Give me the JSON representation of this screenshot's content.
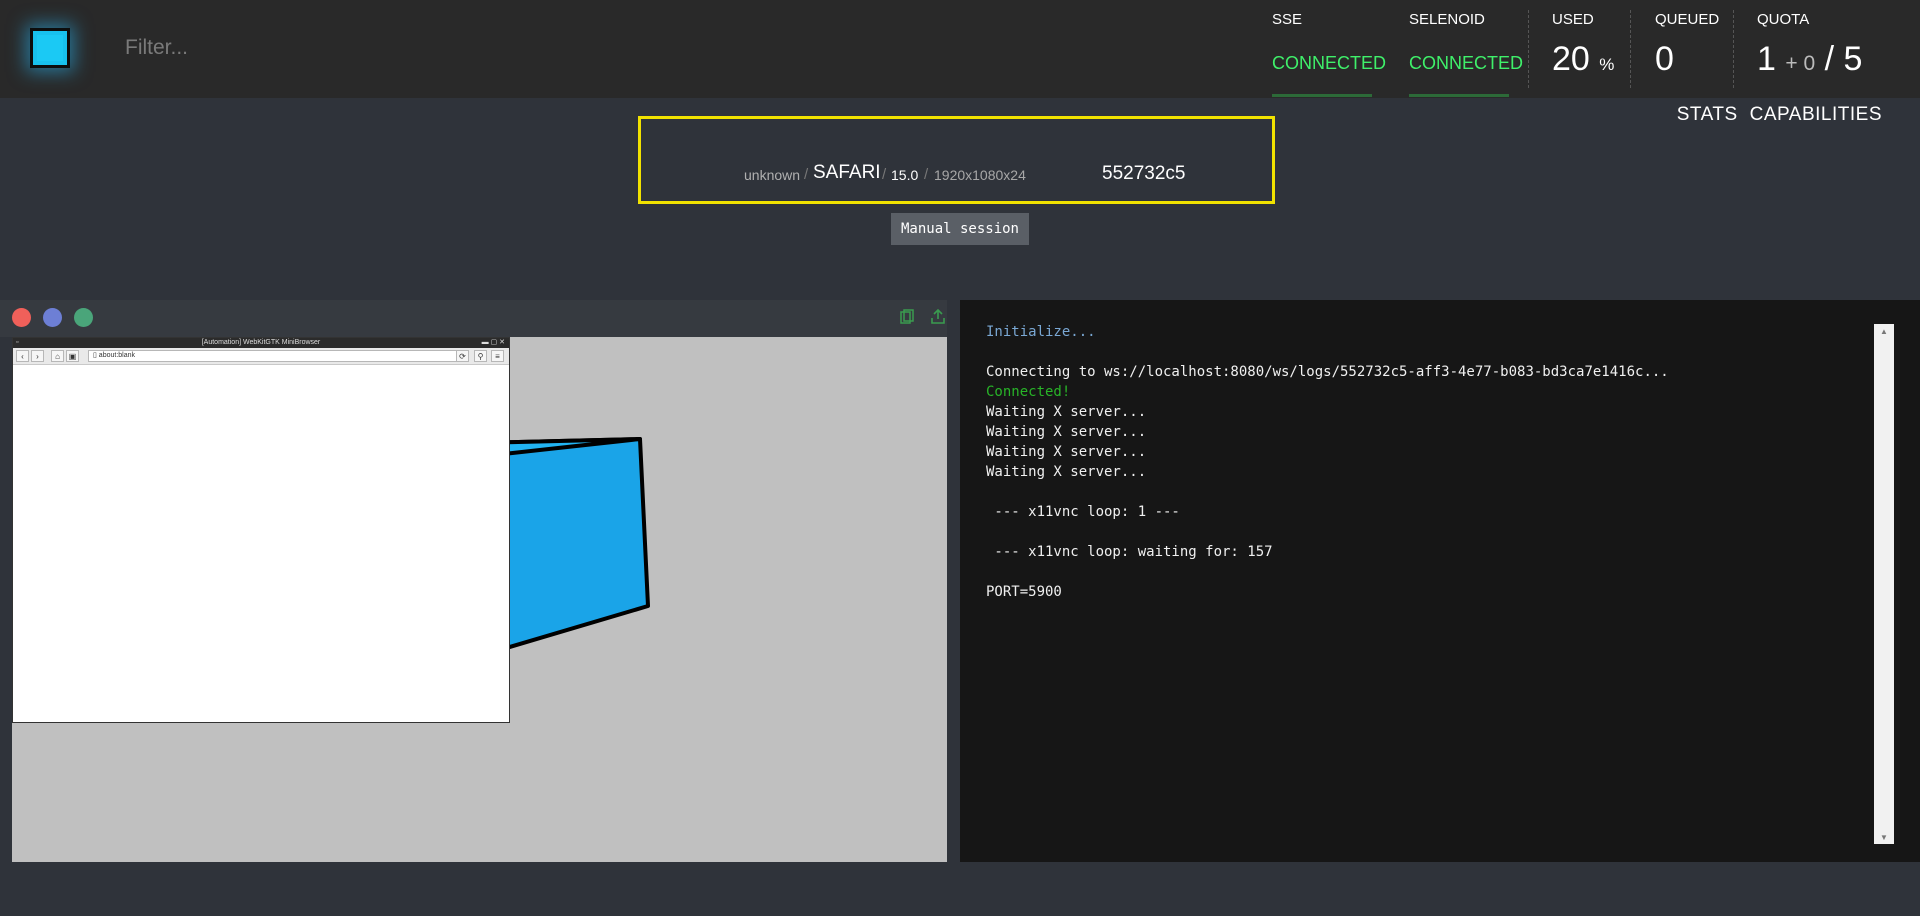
{
  "header": {
    "filter_placeholder": "Filter...",
    "stats": {
      "sse": {
        "label": "SSE",
        "status": "CONNECTED"
      },
      "selenoid": {
        "label": "SELENOID",
        "status": "CONNECTED"
      },
      "used": {
        "label": "USED",
        "value": "20",
        "unit": "%"
      },
      "queued": {
        "label": "QUEUED",
        "value": "0"
      },
      "quota": {
        "label": "QUOTA",
        "used": "1",
        "pending": "+ 0",
        "sep": "/",
        "total": "5"
      }
    },
    "nav": [
      "STATS",
      "CAPABILITIES"
    ]
  },
  "session": {
    "platform": "unknown",
    "browser": "SAFARI",
    "version": "15.0",
    "resolution": "1920x1080x24",
    "id": "552732c5",
    "manual_label": "Manual session"
  },
  "vnc": {
    "window_title": "[Automation] WebKitGTK MiniBrowser",
    "url": "about:blank",
    "colors": {
      "bg": "#c0c0c0",
      "cube": "#1aa4e8"
    }
  },
  "log": {
    "lines": [
      {
        "text": "Initialize...",
        "kind": "info"
      },
      {
        "text": "",
        "kind": "plain"
      },
      {
        "text": "Connecting to ws://localhost:8080/ws/logs/552732c5-aff3-4e77-b083-bd3ca7e1416c...",
        "kind": "plain"
      },
      {
        "text": "Connected!",
        "kind": "ok"
      },
      {
        "text": "Waiting X server...",
        "kind": "plain"
      },
      {
        "text": "Waiting X server...",
        "kind": "plain"
      },
      {
        "text": "Waiting X server...",
        "kind": "plain"
      },
      {
        "text": "Waiting X server...",
        "kind": "plain"
      },
      {
        "text": "",
        "kind": "plain"
      },
      {
        "text": " --- x11vnc loop: 1 ---",
        "kind": "plain"
      },
      {
        "text": "",
        "kind": "plain"
      },
      {
        "text": " --- x11vnc loop: waiting for: 157",
        "kind": "plain"
      },
      {
        "text": "",
        "kind": "plain"
      },
      {
        "text": "PORT=5900",
        "kind": "plain"
      }
    ]
  },
  "colors": {
    "connected": "#3ff06a",
    "highlight": "#f1e200",
    "accent": "#18c1ee"
  }
}
